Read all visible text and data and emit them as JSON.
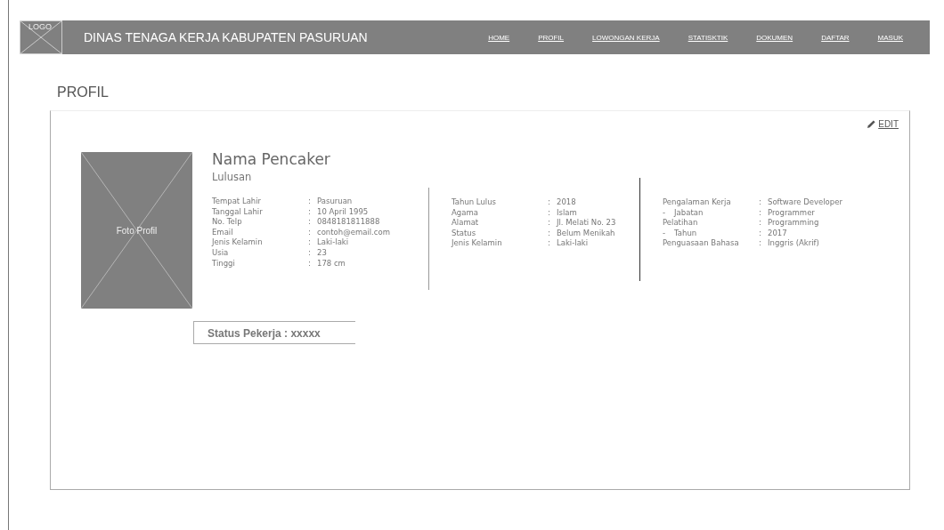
{
  "header": {
    "logo": "LOGO",
    "title": "DINAS TENAGA KERJA KABUPATEN PASURUAN",
    "nav": [
      {
        "label": "HOME"
      },
      {
        "label": "PROFIL"
      },
      {
        "label": "LOWONGAN KERJA"
      },
      {
        "label": "STATISKTIK"
      },
      {
        "label": "DOKUMEN"
      },
      {
        "label": "DAFTAR"
      },
      {
        "label": "MASUK"
      }
    ]
  },
  "page_title": "PROFIL",
  "profile": {
    "edit": "EDIT",
    "photo": "Foto Profil",
    "name": "Nama Pencaker",
    "subtitle": "Lulusan",
    "columns": [
      [
        {
          "label": "Tempat Lahir",
          "colon": ":",
          "value": "Pasuruan"
        },
        {
          "label": "Tanggal Lahir",
          "colon": ":",
          "value": "10 April 1995"
        },
        {
          "label": "No. Telp",
          "colon": ":",
          "value": "0848181811888"
        },
        {
          "label": "Email",
          "colon": ":",
          "value": "contoh@email.com"
        },
        {
          "label": "Jenis Kelamin",
          "colon": ":",
          "value": "Laki-laki"
        },
        {
          "label": "Usia",
          "colon": ":",
          "value": "23"
        },
        {
          "label": "Tinggi",
          "colon": ":",
          "value": "178 cm"
        }
      ],
      [
        {
          "label": "Tahun Lulus",
          "colon": ":",
          "value": "2018"
        },
        {
          "label": "Agama",
          "colon": ":",
          "value": "Islam"
        },
        {
          "label": "Alamat",
          "colon": ":",
          "value": "Jl. Melati No. 23"
        },
        {
          "label": "Status",
          "colon": ":",
          "value": "Belum Menikah"
        },
        {
          "label": "Jenis Kelamin",
          "colon": ":",
          "value": "Laki-laki"
        }
      ],
      [
        {
          "label": "Pengalaman Kerja",
          "colon": ":",
          "value": "Software Developer"
        },
        {
          "bullet": "-",
          "label": "Jabatan",
          "colon": ":",
          "value": "Programmer"
        },
        {
          "label": "Pelatihan",
          "colon": ":",
          "value": "Programming"
        },
        {
          "bullet": "-",
          "label": "Tahun",
          "colon": ":",
          "value": "2017"
        },
        {
          "label": "Penguasaan Bahasa",
          "colon": ":",
          "value": "Inggris (Akrif)"
        }
      ]
    ],
    "status": "Status Pekerja : xxxxx"
  }
}
